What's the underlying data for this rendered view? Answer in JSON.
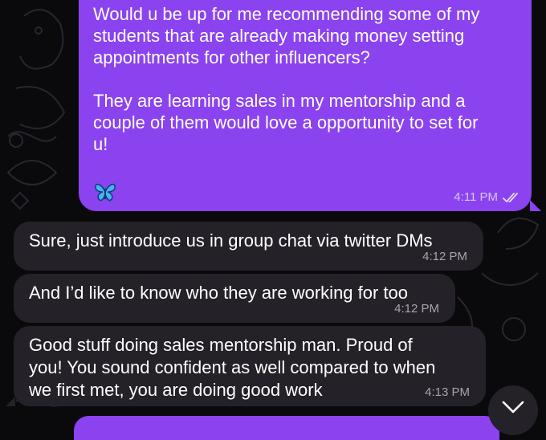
{
  "messages": [
    {
      "direction": "outgoing",
      "text": "Would u be up for me recommending some of my\nstudents that are already making money setting\nappointments for other influencers?\n\nThey are learning sales in my mentorship and a\ncouple of them would love a opportunity to set for\nu!",
      "emoji": "butterfly",
      "time": "4:11 PM",
      "status": "read"
    },
    {
      "direction": "incoming",
      "text": "Sure, just introduce us in group chat via twitter DMs",
      "time": "4:12 PM"
    },
    {
      "direction": "incoming",
      "text": "And I’d like to know who they are working for too",
      "time": "4:12 PM"
    },
    {
      "direction": "incoming",
      "text": "Good stuff doing sales mentorship man. Proud of\nyou! You sound confident as well compared to when\nwe first met, you are doing good work",
      "time": "4:13 PM"
    }
  ],
  "colors": {
    "outgoing_bubble": "#8b43f0",
    "incoming_bubble": "#252129",
    "background": "#0a090c"
  },
  "controls": {
    "scroll_down_icon": "chevron-down-icon"
  }
}
